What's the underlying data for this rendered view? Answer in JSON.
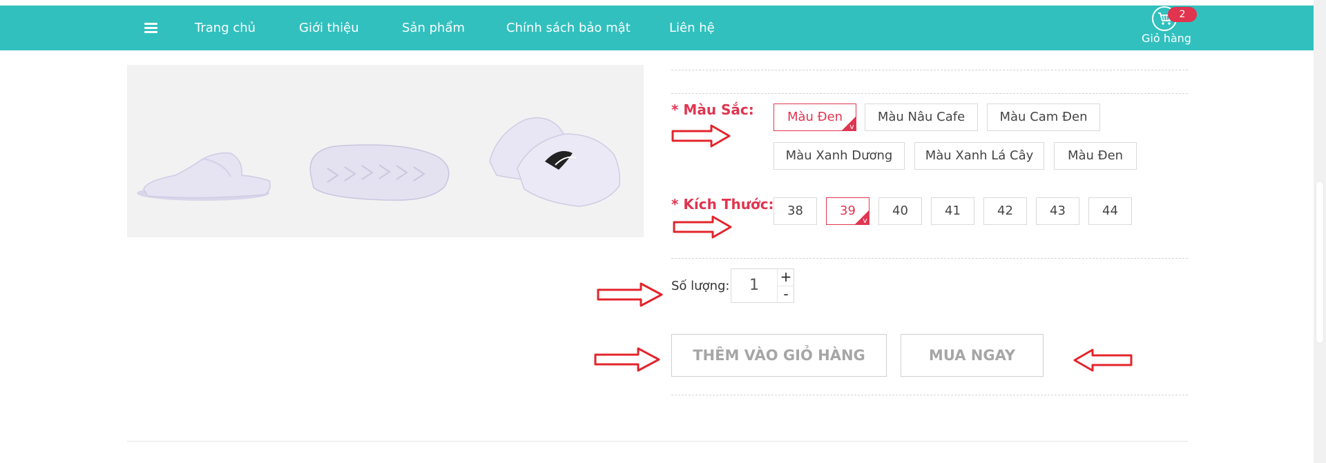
{
  "nav": {
    "menu_icon": "hamburger-icon",
    "items": [
      {
        "label": "Trang chủ"
      },
      {
        "label": "Giới thiệu"
      },
      {
        "label": "Sản phẩm"
      },
      {
        "label": "Chính sách bảo mật"
      },
      {
        "label": "Liên hệ"
      }
    ],
    "cart": {
      "icon": "shopping-cart-icon",
      "count": "2",
      "label": "Giỏ hàng"
    }
  },
  "colors": {
    "navbar": "#31c0be",
    "accent": "#e03550",
    "annotation_arrow": "#e3242b",
    "product": "#e6e3f3"
  },
  "gallery": {
    "thumbnails": [
      "slide-sandal-side",
      "slide-sandal-sole",
      "slide-sandal-pair"
    ]
  },
  "color_option": {
    "label": "* Màu Sắc:",
    "options": [
      {
        "label": "Màu Đen",
        "selected": true
      },
      {
        "label": "Màu Nâu Cafe",
        "selected": false
      },
      {
        "label": "Màu Cam Đen",
        "selected": false
      },
      {
        "label": "Màu Xanh Dương",
        "selected": false
      },
      {
        "label": "Màu Xanh Lá Cây",
        "selected": false
      },
      {
        "label": "Màu Đen",
        "selected": false
      }
    ]
  },
  "size_option": {
    "label": "* Kích Thước:",
    "options": [
      {
        "label": "38",
        "selected": false
      },
      {
        "label": "39",
        "selected": true
      },
      {
        "label": "40",
        "selected": false
      },
      {
        "label": "41",
        "selected": false
      },
      {
        "label": "42",
        "selected": false
      },
      {
        "label": "43",
        "selected": false
      },
      {
        "label": "44",
        "selected": false
      }
    ]
  },
  "check_mark": "v",
  "quantity": {
    "label": "Số lượng:",
    "value": "1",
    "plus": "+",
    "minus": "-"
  },
  "actions": {
    "add_to_cart": "THÊM VÀO GIỎ HÀNG",
    "buy_now": "MUA NGAY"
  }
}
